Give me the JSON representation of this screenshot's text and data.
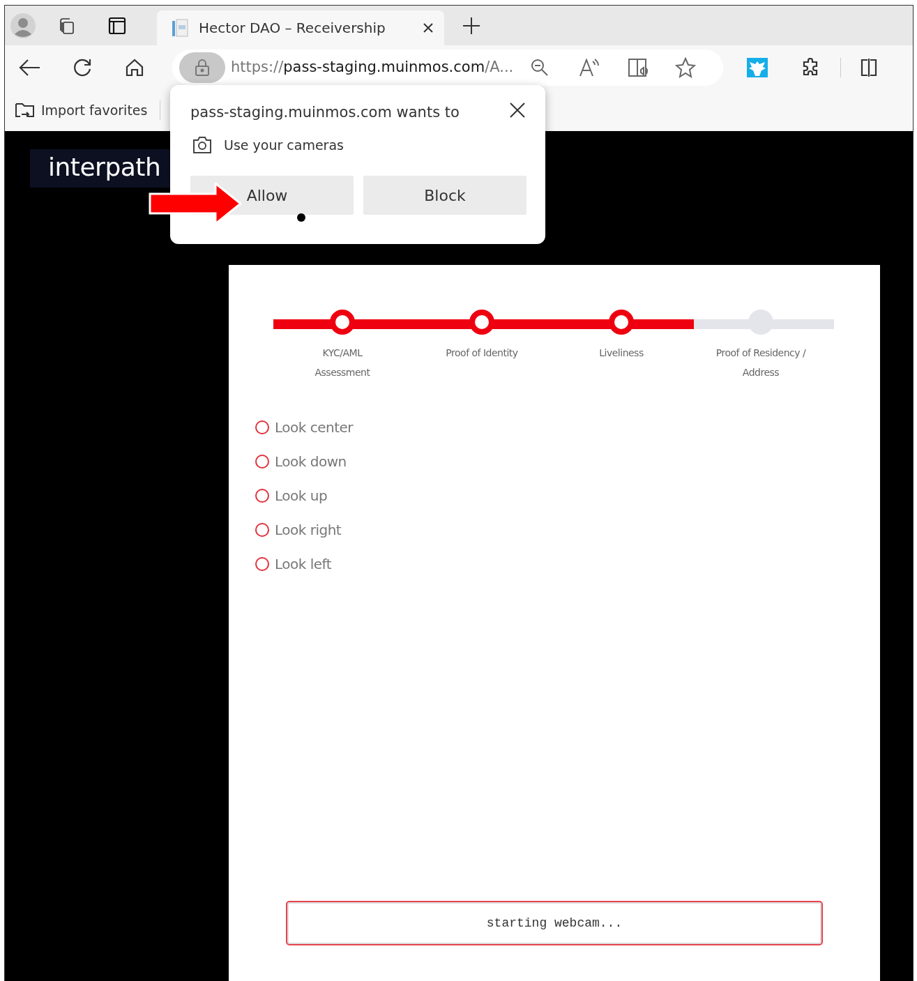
{
  "browser": {
    "tab": {
      "title": "Hector DAO – Receivership",
      "selected": true
    },
    "address": {
      "scheme": "https://",
      "host": "pass-staging.muinmos.com",
      "path": "/A..."
    },
    "favorites_bar": {
      "import_label": "Import favorites"
    }
  },
  "permission_popup": {
    "title": "pass-staging.muinmos.com wants to",
    "permission": "Use your cameras",
    "buttons": [
      {
        "label": "Allow",
        "kind": "allow"
      },
      {
        "label": "Block",
        "kind": "block"
      }
    ]
  },
  "logo": {
    "text": "interpath"
  },
  "stepper": {
    "steps": [
      {
        "label": "KYC/AML Assessment",
        "completed": true
      },
      {
        "label": "Proof of Identity",
        "completed": true
      },
      {
        "label": "Liveliness",
        "completed": true
      },
      {
        "label": "Proof of Residency / Address",
        "completed": false
      }
    ]
  },
  "checklist": [
    {
      "label": "Look center",
      "checked": false
    },
    {
      "label": "Look down",
      "checked": false
    },
    {
      "label": "Look up",
      "checked": false
    },
    {
      "label": "Look right",
      "checked": false
    },
    {
      "label": "Look left",
      "checked": false
    }
  ],
  "status_field": {
    "value": "starting webcam..."
  }
}
